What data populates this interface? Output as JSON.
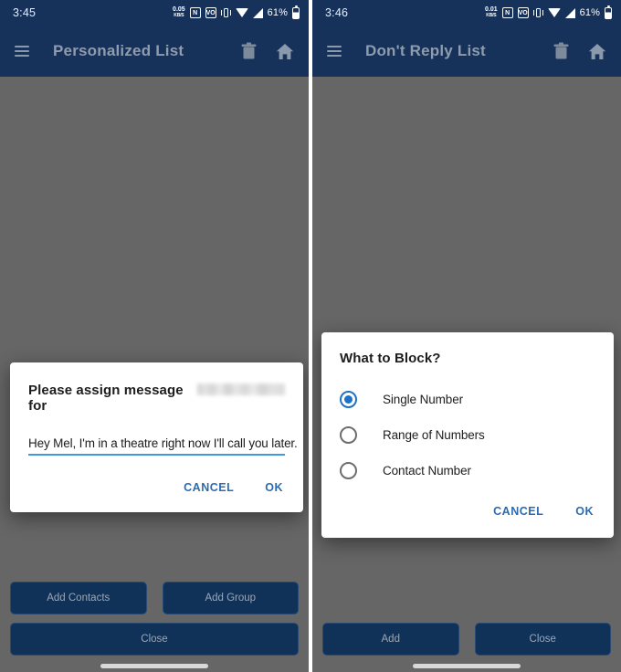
{
  "screens": [
    {
      "status": {
        "time": "3:45",
        "net_speed": "0.05",
        "net_speed_unit": "KB/S",
        "nfc_icon": "nfc-icon",
        "volte_icon": "volte-icon",
        "vibrate_icon": "vibrate-icon",
        "wifi_icon": "wifi-icon",
        "signal_icon": "signal-icon",
        "battery_percent": "61%",
        "battery_icon": "battery-icon"
      },
      "appbar": {
        "menu_icon": "hamburger-menu-icon",
        "title": "Personalized List",
        "delete_icon": "trash-icon",
        "home_icon": "home-icon"
      },
      "dialog": {
        "type": "input",
        "title": "Please assign message for",
        "subject_redacted": true,
        "input_value": "Hey Mel, I'm in a theatre right now I'll call you later.",
        "cancel_label": "CANCEL",
        "ok_label": "OK"
      },
      "bottom_buttons": {
        "row1": [
          "Add Contacts",
          "Add Group"
        ],
        "row2": [
          "Close"
        ]
      }
    },
    {
      "status": {
        "time": "3:46",
        "net_speed": "0.01",
        "net_speed_unit": "KB/S",
        "nfc_icon": "nfc-icon",
        "volte_icon": "volte-icon",
        "vibrate_icon": "vibrate-icon",
        "wifi_icon": "wifi-icon",
        "signal_icon": "signal-icon",
        "battery_percent": "61%",
        "battery_icon": "battery-icon"
      },
      "appbar": {
        "menu_icon": "hamburger-menu-icon",
        "title": "Don't Reply List",
        "delete_icon": "trash-icon",
        "home_icon": "home-icon"
      },
      "dialog": {
        "type": "radio",
        "title": "What to Block?",
        "options": [
          {
            "label": "Single Number",
            "selected": true
          },
          {
            "label": "Range of Numbers",
            "selected": false
          },
          {
            "label": "Contact Number",
            "selected": false
          }
        ],
        "cancel_label": "CANCEL",
        "ok_label": "OK"
      },
      "bottom_buttons": {
        "row1": [
          "Add",
          "Close"
        ]
      }
    }
  ],
  "colors": {
    "appbar": "#17325a",
    "scrim": "#666666",
    "button": "#113258",
    "accent_blue": "#2c6bb0",
    "radio_blue": "#1a73c8",
    "field_underline": "#3d9ae0"
  }
}
